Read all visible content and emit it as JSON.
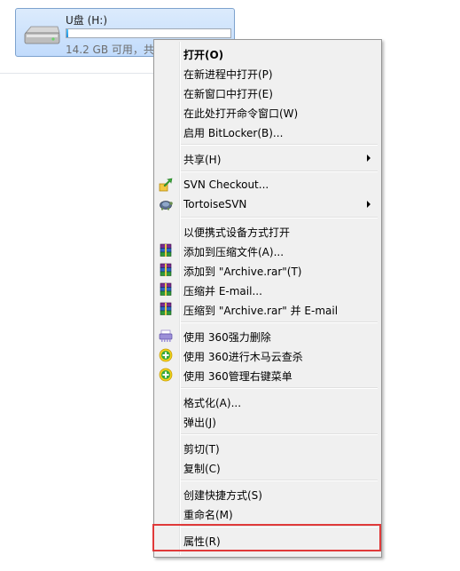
{
  "drive": {
    "name": "U盘 (H:)",
    "free_text": "14.2 GB 可用，共",
    "used_fraction": 0.01,
    "icon": "usb-drive-icon"
  },
  "menu": {
    "items": [
      {
        "label": "打开(O)",
        "bold": true
      },
      {
        "label": "在新进程中打开(P)"
      },
      {
        "label": "在新窗口中打开(E)"
      },
      {
        "label": "在此处打开命令窗口(W)"
      },
      {
        "label": "启用 BitLocker(B)..."
      },
      {
        "label": "共享(H)",
        "submenu": true
      },
      {
        "label": "SVN Checkout...",
        "icon": "svn-checkout-icon"
      },
      {
        "label": "TortoiseSVN",
        "icon": "tortoisesvn-icon",
        "submenu": true
      },
      {
        "label": "以便携式设备方式打开"
      },
      {
        "label": "添加到压缩文件(A)...",
        "icon": "winrar-icon"
      },
      {
        "label": "添加到 \"Archive.rar\"(T)",
        "icon": "winrar-icon"
      },
      {
        "label": "压缩并 E-mail...",
        "icon": "winrar-icon"
      },
      {
        "label": "压缩到 \"Archive.rar\" 并 E-mail",
        "icon": "winrar-icon"
      },
      {
        "label": "使用 360强力删除",
        "icon": "360-shred-icon"
      },
      {
        "label": "使用 360进行木马云查杀",
        "icon": "360-plus-icon"
      },
      {
        "label": "使用 360管理右键菜单",
        "icon": "360-plus-icon"
      },
      {
        "label": "格式化(A)..."
      },
      {
        "label": "弹出(J)"
      },
      {
        "label": "剪切(T)"
      },
      {
        "label": "复制(C)"
      },
      {
        "label": "创建快捷方式(S)"
      },
      {
        "label": "重命名(M)"
      },
      {
        "label": "属性(R)"
      }
    ]
  },
  "colors": {
    "highlight_border": "#e03a3a",
    "menu_background": "#f0f0f0",
    "selection_tile": "#c1dbfc"
  }
}
